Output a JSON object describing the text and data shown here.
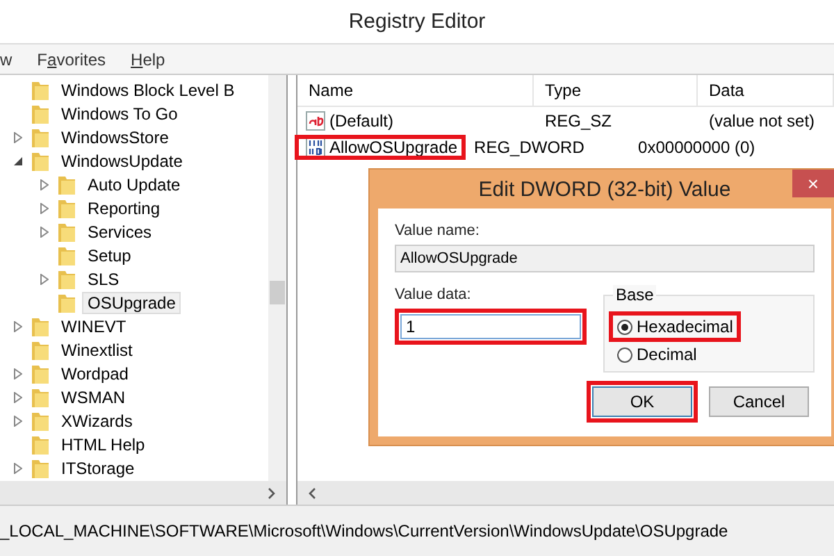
{
  "window": {
    "title": "Registry Editor"
  },
  "menu": [
    {
      "before": "w"
    },
    {
      "before": "F",
      "accel": "a",
      "after": "vorites"
    },
    {
      "accel": "H",
      "after": "elp"
    }
  ],
  "tree": [
    {
      "children": [
        {
          "label": "Windows Block Level B",
          "selected": false
        },
        {
          "label": "Windows To Go",
          "selected": false
        },
        {
          "label": "WindowsStore",
          "expanded": false,
          "selected": false
        },
        {
          "label": "WindowsUpdate",
          "expanded": true,
          "selected": false,
          "children": [
            {
              "label": "Auto Update",
              "expanded": false,
              "selected": false
            },
            {
              "label": "Reporting",
              "expanded": false,
              "selected": false
            },
            {
              "label": "Services",
              "expanded": false,
              "selected": false
            },
            {
              "label": "Setup",
              "selected": false
            },
            {
              "label": "SLS",
              "expanded": false,
              "selected": false
            },
            {
              "label": "OSUpgrade",
              "selected": true
            }
          ]
        },
        {
          "label": "WINEVT",
          "expanded": false,
          "selected": false
        },
        {
          "label": "Winextlist",
          "selected": false
        },
        {
          "label": "Wordpad",
          "expanded": false,
          "selected": false
        },
        {
          "label": "WSMAN",
          "expanded": false,
          "selected": false
        },
        {
          "label": "XWizards",
          "expanded": false,
          "selected": false
        }
      ]
    },
    {
      "label": "HTML Help",
      "selected": false
    },
    {
      "label": "ITStorage",
      "expanded": false,
      "selected": false
    }
  ],
  "values_table": {
    "columns": [
      "Name",
      "Type",
      "Data"
    ],
    "rows": [
      {
        "kind": "string",
        "name": "(Default)",
        "type": "REG_SZ",
        "data": "(value not set)",
        "highlighted": false
      },
      {
        "kind": "binary",
        "name": "AllowOSUpgrade",
        "type": "REG_DWORD",
        "data": "0x00000000 (0)",
        "highlighted": true
      }
    ]
  },
  "dialog": {
    "title": "Edit DWORD (32-bit) Value",
    "close": "×",
    "value_name_label": "Value name:",
    "value_name": "AllowOSUpgrade",
    "value_data_label": "Value data:",
    "value_data": "1",
    "value_data_highlighted": true,
    "base_label": "Base",
    "base_options": [
      {
        "label": "Hexadecimal",
        "selected": true,
        "highlighted": true
      },
      {
        "label": "Decimal",
        "selected": false,
        "highlighted": false
      }
    ],
    "buttons": [
      {
        "label": "OK",
        "default": true,
        "highlighted": true
      },
      {
        "label": "Cancel",
        "default": false,
        "highlighted": false
      }
    ]
  },
  "status_bar": {
    "path": "_LOCAL_MACHINE\\SOFTWARE\\Microsoft\\Windows\\CurrentVersion\\WindowsUpdate\\OSUpgrade"
  }
}
